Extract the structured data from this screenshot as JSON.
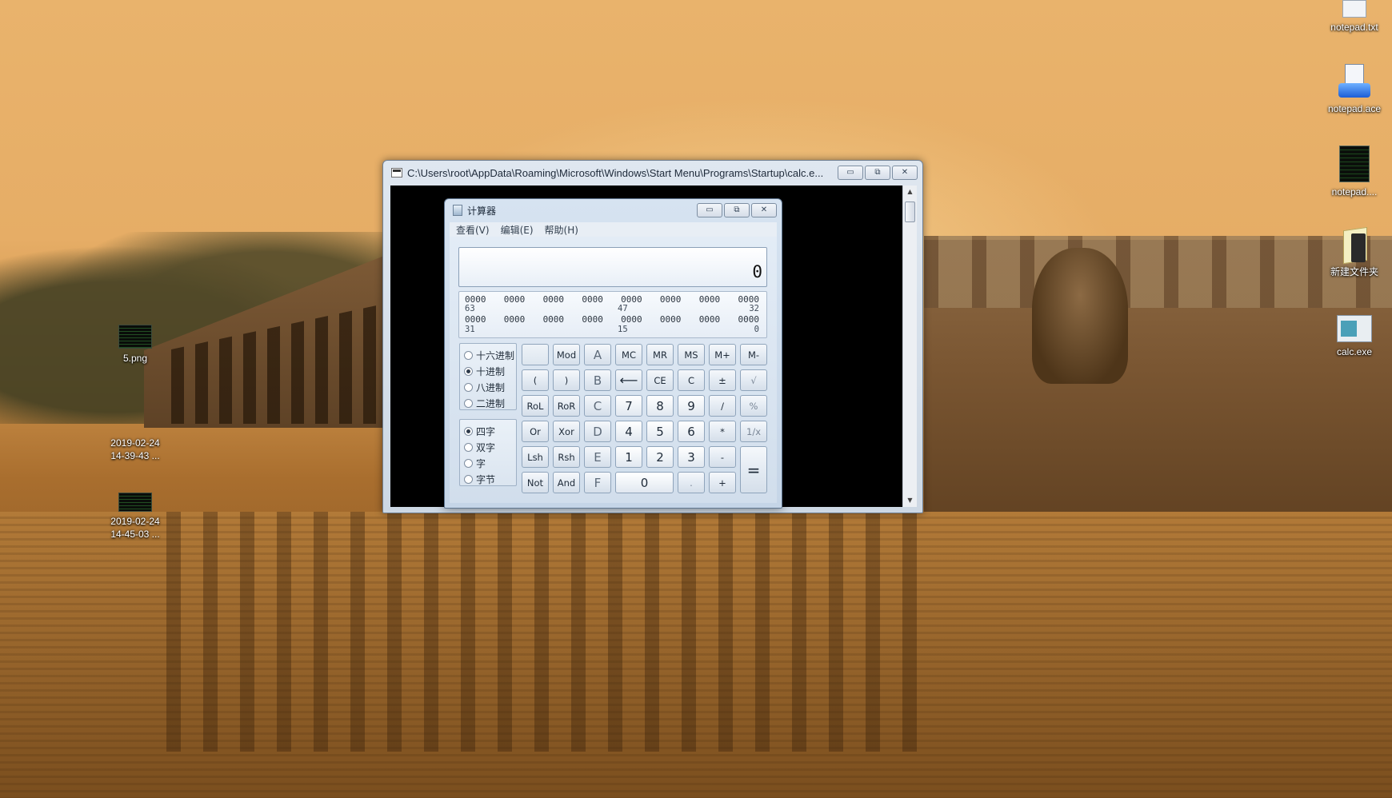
{
  "desktop": {
    "icons": [
      {
        "label": "notepad.txt",
        "icon": "text-file-icon"
      },
      {
        "label": "notepad.ace",
        "icon": "installer-icon"
      },
      {
        "label": "notepad....",
        "icon": "terminal-icon"
      },
      {
        "label": "新建文件夹",
        "icon": "folder-icon"
      },
      {
        "label": "calc.exe",
        "icon": "application-icon"
      },
      {
        "label": "5.png",
        "icon": "image-icon"
      },
      {
        "label": "2019-02-24\n14-39-43 ...",
        "line1": "2019-02-24",
        "line2": "14-39-43 ...",
        "icon": "image-icon"
      },
      {
        "label": "2019-02-24\n14-45-03 ...",
        "line1": "2019-02-24",
        "line2": "14-45-03 ...",
        "icon": "image-icon"
      }
    ]
  },
  "console": {
    "title": "C:\\Users\\root\\AppData\\Roaming\\Microsoft\\Windows\\Start Menu\\Programs\\Startup\\calc.e..."
  },
  "calculator": {
    "title": "计算器",
    "menu": [
      "查看(V)",
      "编辑(E)",
      "帮助(H)"
    ],
    "display_value": "0",
    "bit_rows": [
      {
        "groups": [
          "0000",
          "0000",
          "0000",
          "0000",
          "0000",
          "0000",
          "0000",
          "0000"
        ],
        "labels": [
          "63",
          "47",
          "32"
        ]
      },
      {
        "groups": [
          "0000",
          "0000",
          "0000",
          "0000",
          "0000",
          "0000",
          "0000",
          "0000"
        ],
        "labels": [
          "31",
          "15",
          "0"
        ]
      }
    ],
    "radix": {
      "options": [
        "十六进制",
        "十进制",
        "八进制",
        "二进制"
      ],
      "selected": "十进制"
    },
    "word_size": {
      "options": [
        "四字",
        "双字",
        "字",
        "字节"
      ],
      "selected": "四字"
    },
    "keys": {
      "row1": [
        "",
        "Mod",
        "A",
        "MC",
        "MR",
        "MS",
        "M+",
        "M-"
      ],
      "row2": [
        "(",
        ")",
        "B",
        "⟵",
        "CE",
        "C",
        "±",
        "√"
      ],
      "row3": [
        "RoL",
        "RoR",
        "C",
        "7",
        "8",
        "9",
        "/",
        "%"
      ],
      "row4": [
        "Or",
        "Xor",
        "D",
        "4",
        "5",
        "6",
        "*",
        "1/x"
      ],
      "row5": [
        "Lsh",
        "Rsh",
        "E",
        "1",
        "2",
        "3",
        "-",
        "="
      ],
      "row6": [
        "Not",
        "And",
        "F",
        "0",
        ".",
        "+"
      ]
    }
  }
}
